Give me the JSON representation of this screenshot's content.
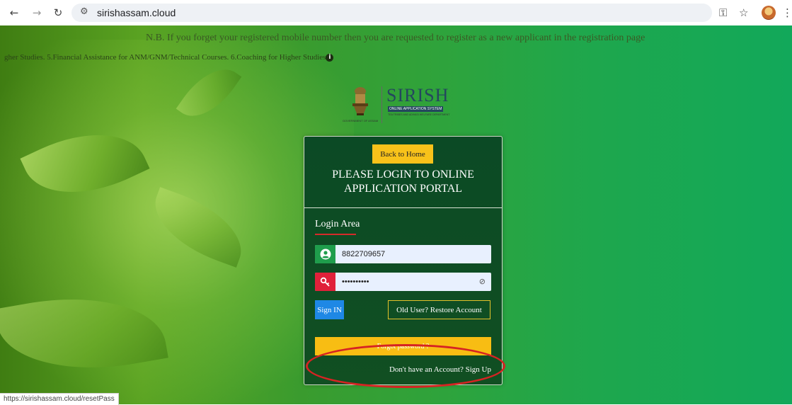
{
  "browser": {
    "url": "sirishassam.cloud",
    "back_icon": "arrow-left-icon",
    "forward_icon": "arrow-right-icon",
    "reload_icon": "reload-icon",
    "site_info_icon": "tune-icon",
    "password_icon": "key-icon",
    "bookmark_icon": "star-icon",
    "menu_icon": "kebab-menu-icon"
  },
  "page": {
    "notice": "N.B. If you forget your registered mobile number then you are requested to register as a new applicant in the registration page",
    "scheme_marquee": "gher Studies. 5.Financial Assistance for ANM/GNM/Technical Courses. 6.Coaching for Higher Studies",
    "info_glyph": "i"
  },
  "logo": {
    "title": "SIRISH",
    "subtitle": "ONLINE APPLICATION SYSTEM",
    "department": "TEA TRIBES AND ADIVASI WELFARE DEPARTMENT",
    "emblem_caption": "GOVERNMENT OF ASSAM"
  },
  "login": {
    "back_home": "Back to Home",
    "title_line1": "PLEASE LOGIN TO ONLINE",
    "title_line2": "APPLICATION PORTAL",
    "area_label": "Login Area",
    "mobile_value": "8822709657",
    "password_value": "••••••••••",
    "sign_in": "Sign IN",
    "restore_account": "Old User? Restore Account",
    "forgot_password": "Forgot password ?",
    "no_account_text": "Don't have an Account?",
    "sign_up": "Sign Up"
  },
  "status_bar": {
    "url": "https://sirishassam.cloud/resetPass"
  },
  "colors": {
    "card_bg": "#0b4a25",
    "accent_yellow": "#f8c21a",
    "sign_in_blue": "#1e88e5",
    "user_addon_green": "#1f9d4c",
    "password_addon_red": "#e0213a",
    "highlight_red": "#d62323"
  }
}
